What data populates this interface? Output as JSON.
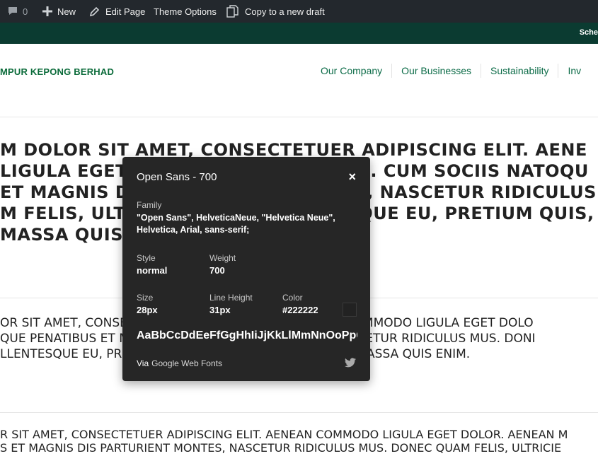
{
  "admin_bar": {
    "comments_count": "0",
    "new_label": "New",
    "edit_label": "Edit Page",
    "theme_label": "Theme Options",
    "copy_label": "Copy to a new draft"
  },
  "top_strip": {
    "text": "Sche"
  },
  "header": {
    "logo_text": "MPUR KEPONG BERHAD",
    "nav": [
      "Our Company",
      "Our Businesses",
      "Sustainability",
      "Inv"
    ]
  },
  "content": {
    "block1": [
      "M DOLOR SIT AMET, CONSECTETUER ADIPISCING ELIT. AENE",
      "LIGULA EGET DOLOR. AENEAN MASSA. CUM SOCIIS NATOQU",
      "ET MAGNIS DIS PARTURIENT MONTES, NASCETUR RIDICULUS",
      "M FELIS, ULTRICIES NEC, PELLENTESQUE EU, PRETIUM QUIS,",
      " MASSA QUIS ENIM."
    ],
    "block2": [
      "OR SIT AMET, CONSECTETUER ADIPISCING ELIT. AENEAN COMMODO LIGULA EGET DOLO",
      "QUE PENATIBUS ET MAGNIS DIS PARTURIENT MONTES, NASCETUR RIDICULUS MUS. DONI",
      "LLENTESQUE EU, PRETIUM QUIS, SEM. NULLA CONSEQUAT MASSA QUIS ENIM."
    ],
    "block3": [
      "R SIT AMET, CONSECTETUER ADIPISCING ELIT. AENEAN COMMODO LIGULA EGET DOLOR. AENEAN M",
      "S ET MAGNIS DIS PARTURIENT MONTES, NASCETUR RIDICULUS MUS. DONEC QUAM FELIS, ULTRICIE"
    ]
  },
  "popup": {
    "title": "Open Sans - 700",
    "close": "×",
    "family_label": "Family",
    "family_value": "\"Open Sans\", HelveticaNeue, \"Helvetica Neue\", Helvetica, Arial, sans-serif;",
    "style_label": "Style",
    "style_value": "normal",
    "weight_label": "Weight",
    "weight_value": "700",
    "size_label": "Size",
    "size_value": "28px",
    "line_height_label": "Line Height",
    "line_height_value": "31px",
    "color_label": "Color",
    "color_value": "#222222",
    "sample": "AaBbCcDdEeFfGgHhIiJjKkLlMmNnOoPpQ",
    "via_label": "Via",
    "via_link": "Google Web Fonts"
  },
  "icons": {
    "comments": "comment-bubble-icon",
    "new": "plus-icon",
    "edit": "pencil-icon",
    "copy": "copy-icon",
    "share": "twitter-icon"
  },
  "colors": {
    "admin_bar": "#23282d",
    "top_strip": "#0b3b31",
    "brand_green": "#0b6b3a",
    "popup_bg": "#262626",
    "text": "#222222"
  }
}
